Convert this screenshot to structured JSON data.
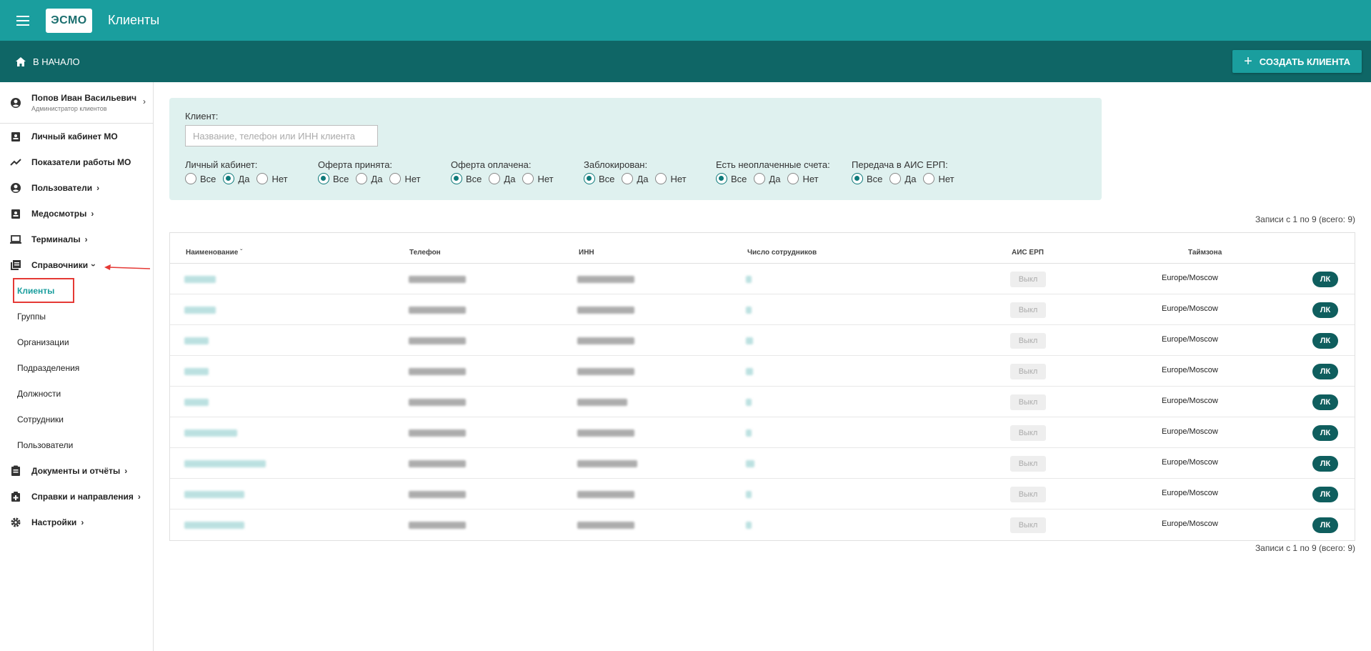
{
  "header": {
    "title": "Клиенты",
    "logo_text": "ЭСМО"
  },
  "subbar": {
    "home_label": "В НАЧАЛО",
    "create_label": "СОЗДАТЬ КЛИЕНТА"
  },
  "sidebar": {
    "user": {
      "name": "Попов Иван Васильевич",
      "role": "Администратор клиентов"
    },
    "items": [
      {
        "label": "Личный кабинет МО",
        "icon": "badge-icon"
      },
      {
        "label": "Показатели работы МО",
        "icon": "trending-icon"
      },
      {
        "label": "Пользователи",
        "icon": "account-circle-icon"
      },
      {
        "label": "Медосмотры",
        "icon": "badge-icon"
      },
      {
        "label": "Терминалы",
        "icon": "laptop-icon"
      },
      {
        "label": "Справочники",
        "icon": "library-icon"
      }
    ],
    "sub_items": [
      "Клиенты",
      "Группы",
      "Организации",
      "Подразделения",
      "Должности",
      "Сотрудники",
      "Пользователи"
    ],
    "bottom_items": [
      {
        "label": "Документы и отчёты",
        "icon": "assignment-icon"
      },
      {
        "label": "Справки и направления",
        "icon": "medical-icon"
      },
      {
        "label": "Настройки",
        "icon": "gear-icon"
      }
    ]
  },
  "filter": {
    "client_label": "Клиент:",
    "client_placeholder": "Название, телефон или ИНН клиента",
    "groups": [
      {
        "title": "Личный кабинет:",
        "options": [
          "Все",
          "Да",
          "Нет"
        ],
        "selected": "Да"
      },
      {
        "title": "Оферта принята:",
        "options": [
          "Все",
          "Да",
          "Нет"
        ],
        "selected": "Все"
      },
      {
        "title": "Оферта оплачена:",
        "options": [
          "Все",
          "Да",
          "Нет"
        ],
        "selected": "Все"
      },
      {
        "title": "Заблокирован:",
        "options": [
          "Все",
          "Да",
          "Нет"
        ],
        "selected": "Все"
      },
      {
        "title": "Есть неоплаченные счета:",
        "options": [
          "Все",
          "Да",
          "Нет"
        ],
        "selected": "Все"
      },
      {
        "title": "Передача в АИС ЕРП:",
        "options": [
          "Все",
          "Да",
          "Нет"
        ],
        "selected": "Все"
      }
    ]
  },
  "records_text": "Записи с 1 по 9 (всего: 9)",
  "table": {
    "headers": [
      "Наименование",
      "Телефон",
      "ИНН",
      "Число сотрудников",
      "АИС ЕРП",
      "Таймзона"
    ],
    "rows": [
      {
        "ais": "Выкл",
        "tz": "Europe/Moscow",
        "lk": "ЛК"
      },
      {
        "ais": "Выкл",
        "tz": "Europe/Moscow",
        "lk": "ЛК"
      },
      {
        "ais": "Выкл",
        "tz": "Europe/Moscow",
        "lk": "ЛК"
      },
      {
        "ais": "Выкл",
        "tz": "Europe/Moscow",
        "lk": "ЛК"
      },
      {
        "ais": "Выкл",
        "tz": "Europe/Moscow",
        "lk": "ЛК"
      },
      {
        "ais": "Выкл",
        "tz": "Europe/Moscow",
        "lk": "ЛК"
      },
      {
        "ais": "Выкл",
        "tz": "Europe/Moscow",
        "lk": "ЛК"
      },
      {
        "ais": "Выкл",
        "tz": "Europe/Moscow",
        "lk": "ЛК"
      },
      {
        "ais": "Выкл",
        "tz": "Europe/Moscow",
        "lk": "ЛК"
      }
    ]
  },
  "colors": {
    "primary": "#1a9e9e",
    "dark": "#0f6666",
    "filter_bg": "#dff1ef",
    "highlight": "#e53935"
  }
}
